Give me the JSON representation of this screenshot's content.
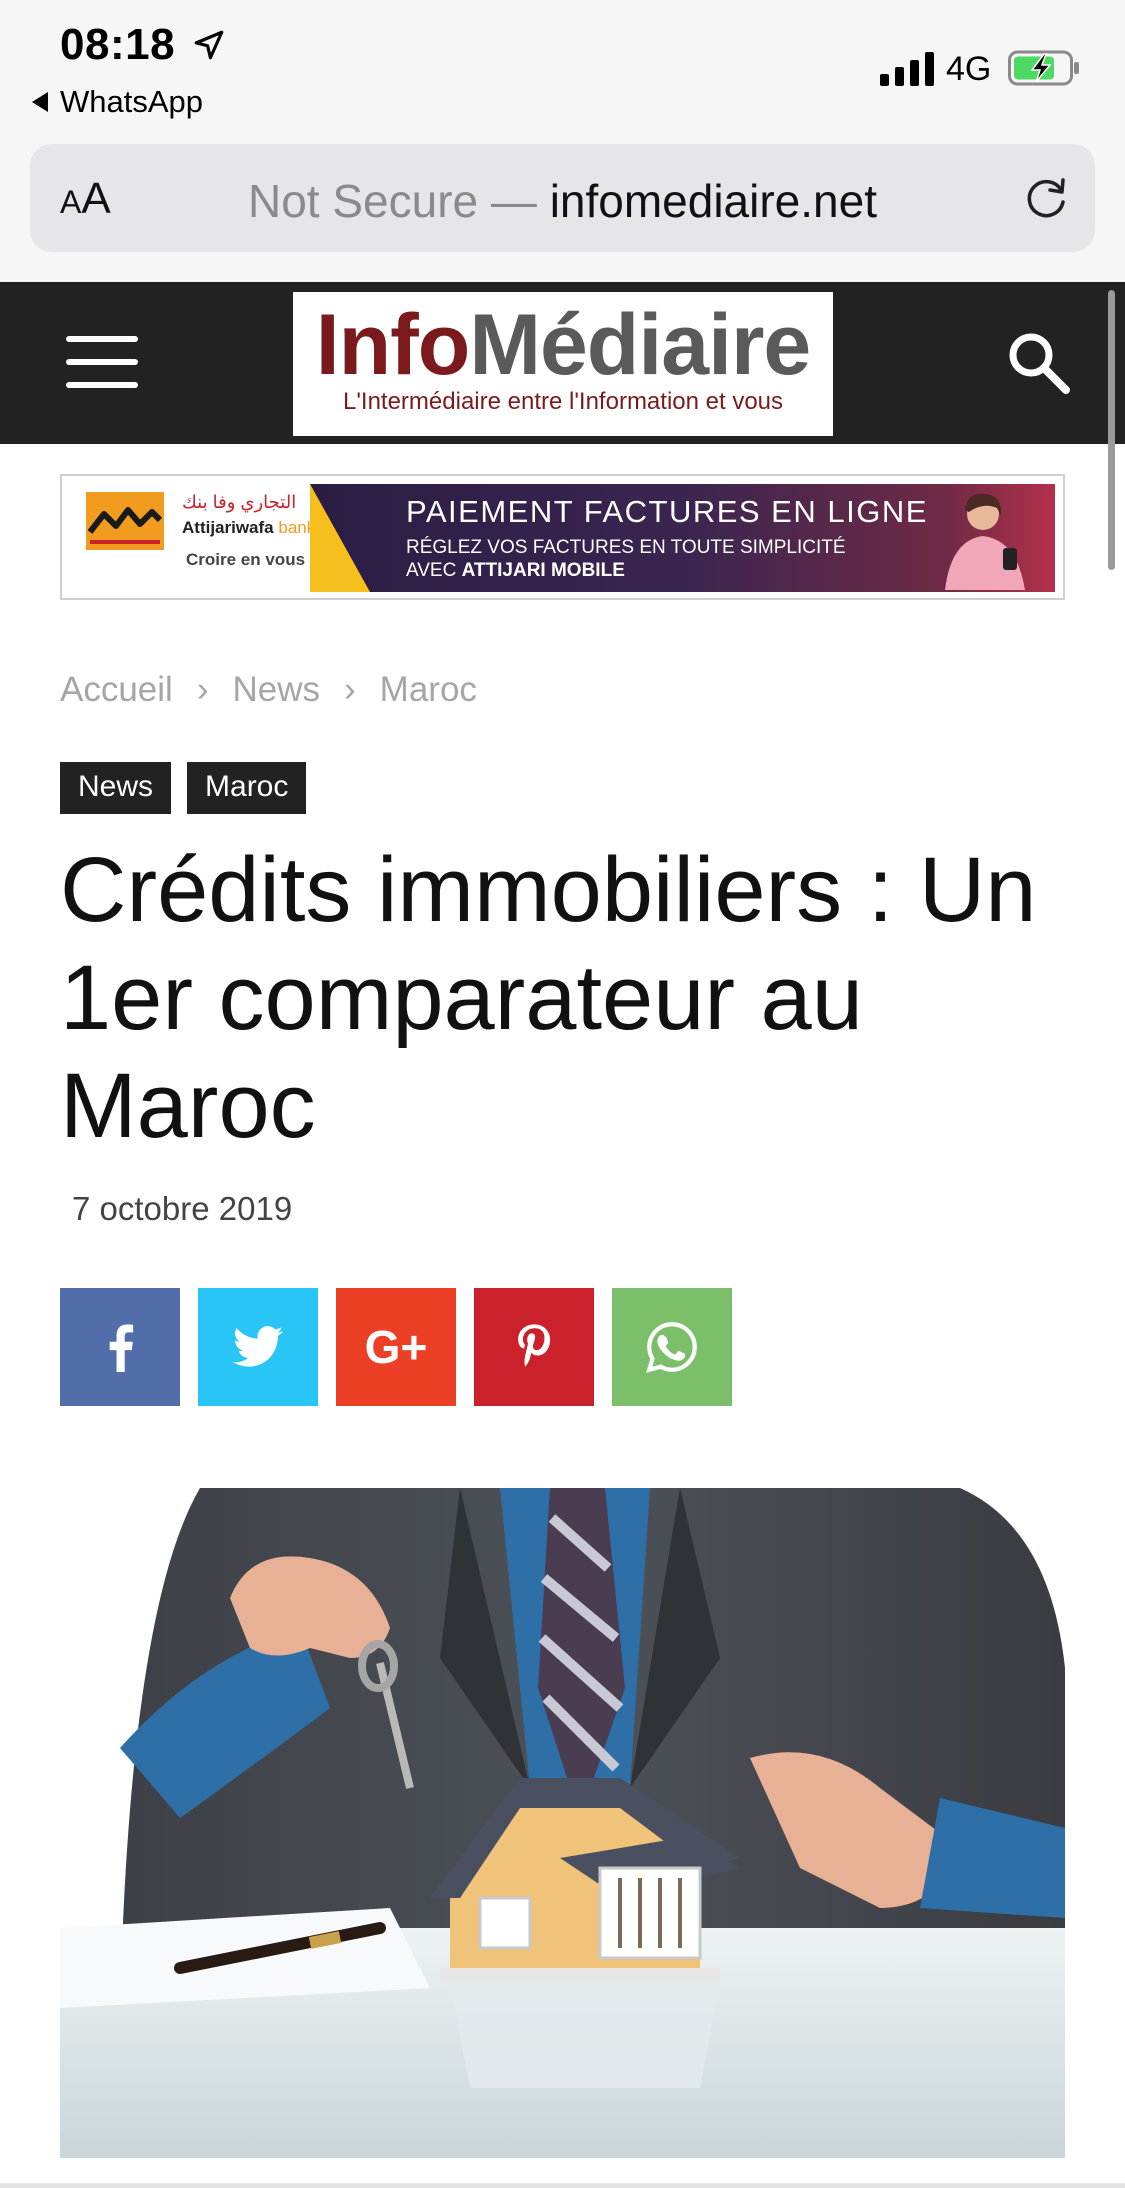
{
  "status_bar": {
    "time": "08:18",
    "back_app": "WhatsApp",
    "network": "4G"
  },
  "address_bar": {
    "text_size_label_small": "A",
    "text_size_label_large": "A",
    "insecure_prefix": "Not Secure — ",
    "host": "infomediaire.net"
  },
  "site": {
    "logo_part1": "Info",
    "logo_part2": "Médiaire",
    "logo_tagline": "L'Intermédiaire entre l'Information et vous"
  },
  "ad": {
    "arabic_name": "التجاري وفا بنك",
    "brand_name": "Attijariwafa",
    "brand_suffix": "bank",
    "slogan": "Croire en vous",
    "title": "PAIEMENT FACTURES EN LIGNE",
    "subtitle_line1": "RÉGLEZ VOS FACTURES EN TOUTE SIMPLICITÉ",
    "subtitle_line2_prefix": "AVEC ",
    "subtitle_line2_bold": "ATTIJARI MOBILE"
  },
  "breadcrumb": {
    "items": [
      "Accueil",
      "News",
      "Maroc"
    ],
    "separator": "›"
  },
  "tags": [
    "News",
    "Maroc"
  ],
  "article": {
    "title": "Crédits immobiliers : Un 1er comparateur au Maroc",
    "date": "7 octobre 2019"
  },
  "share": {
    "buttons": [
      "facebook",
      "twitter",
      "google-plus",
      "pinterest",
      "whatsapp"
    ],
    "colors": {
      "facebook": "#516eab",
      "twitter": "#29c5f6",
      "google_plus": "#eb4026",
      "pinterest": "#ca212a",
      "whatsapp": "#7bbf6a"
    },
    "gplus_label": "G+"
  },
  "icons": {
    "menu": "hamburger-icon",
    "search": "search-icon",
    "reload": "reload-icon",
    "location": "location-arrow-icon"
  },
  "colors": {
    "header_bg": "#222222",
    "logo_red": "#7a1a1d",
    "logo_grey": "#5a5a5a"
  }
}
